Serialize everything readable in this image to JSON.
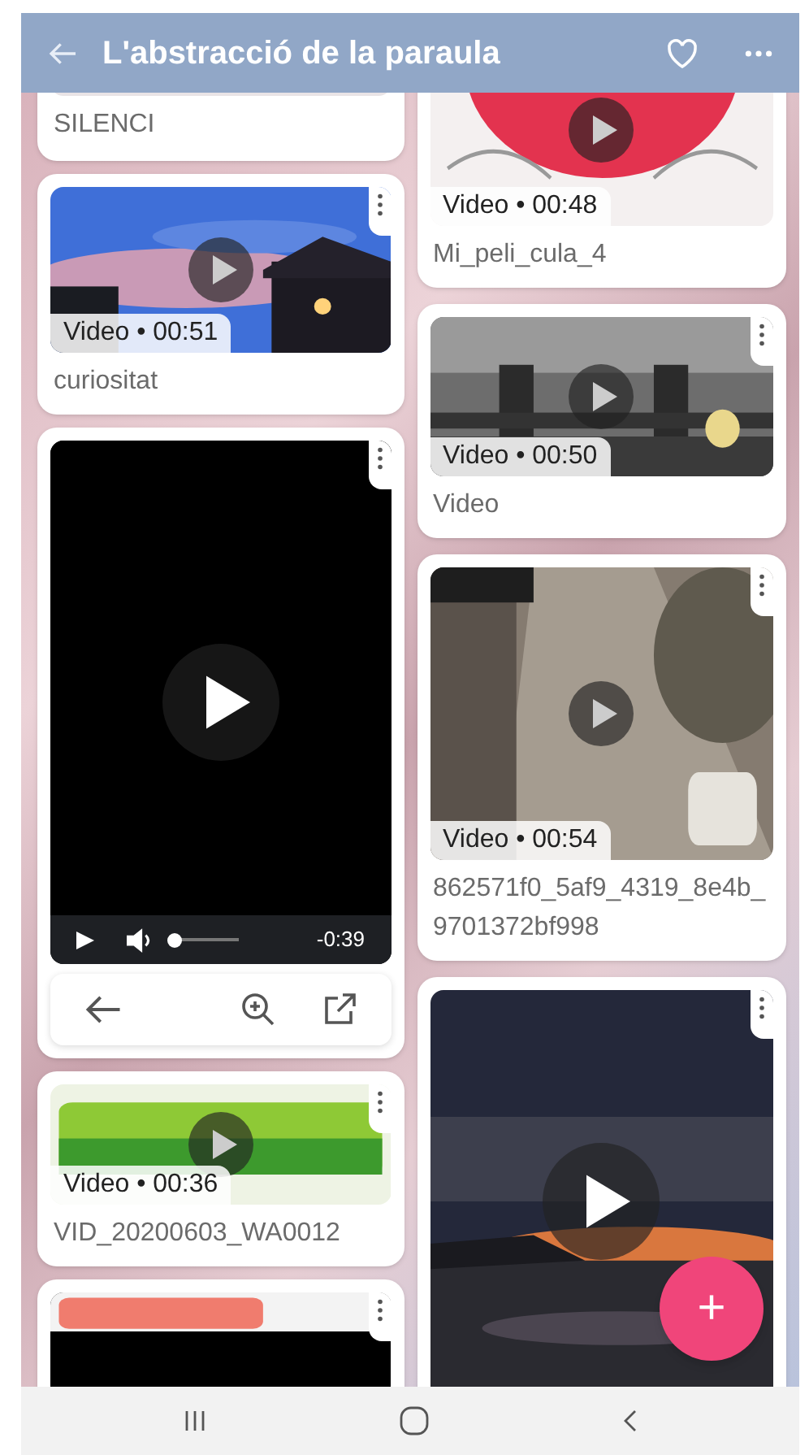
{
  "header": {
    "title": "L'abstracció de la paraula"
  },
  "left_column": [
    {
      "kind": "post",
      "title": "SILENCI"
    },
    {
      "kind": "video",
      "badge": "Video • 00:51",
      "title": "curiositat"
    },
    {
      "kind": "player",
      "time": "-0:39",
      "level": 0.05
    },
    {
      "kind": "video",
      "badge": "Video • 00:36",
      "title": "VID_20200603_WA0012"
    },
    {
      "kind": "thumb"
    }
  ],
  "right_column": [
    {
      "kind": "video",
      "badge": "Video • 00:48",
      "title": "Mi_peli_cula_4"
    },
    {
      "kind": "video",
      "badge": "Video • 00:50",
      "title": "Video"
    },
    {
      "kind": "video",
      "badge": "Video • 00:54",
      "title": "862571f0_5af9_4319_8e4b_9701372bf998"
    },
    {
      "kind": "thumb"
    }
  ],
  "fab": {
    "label": "+"
  }
}
